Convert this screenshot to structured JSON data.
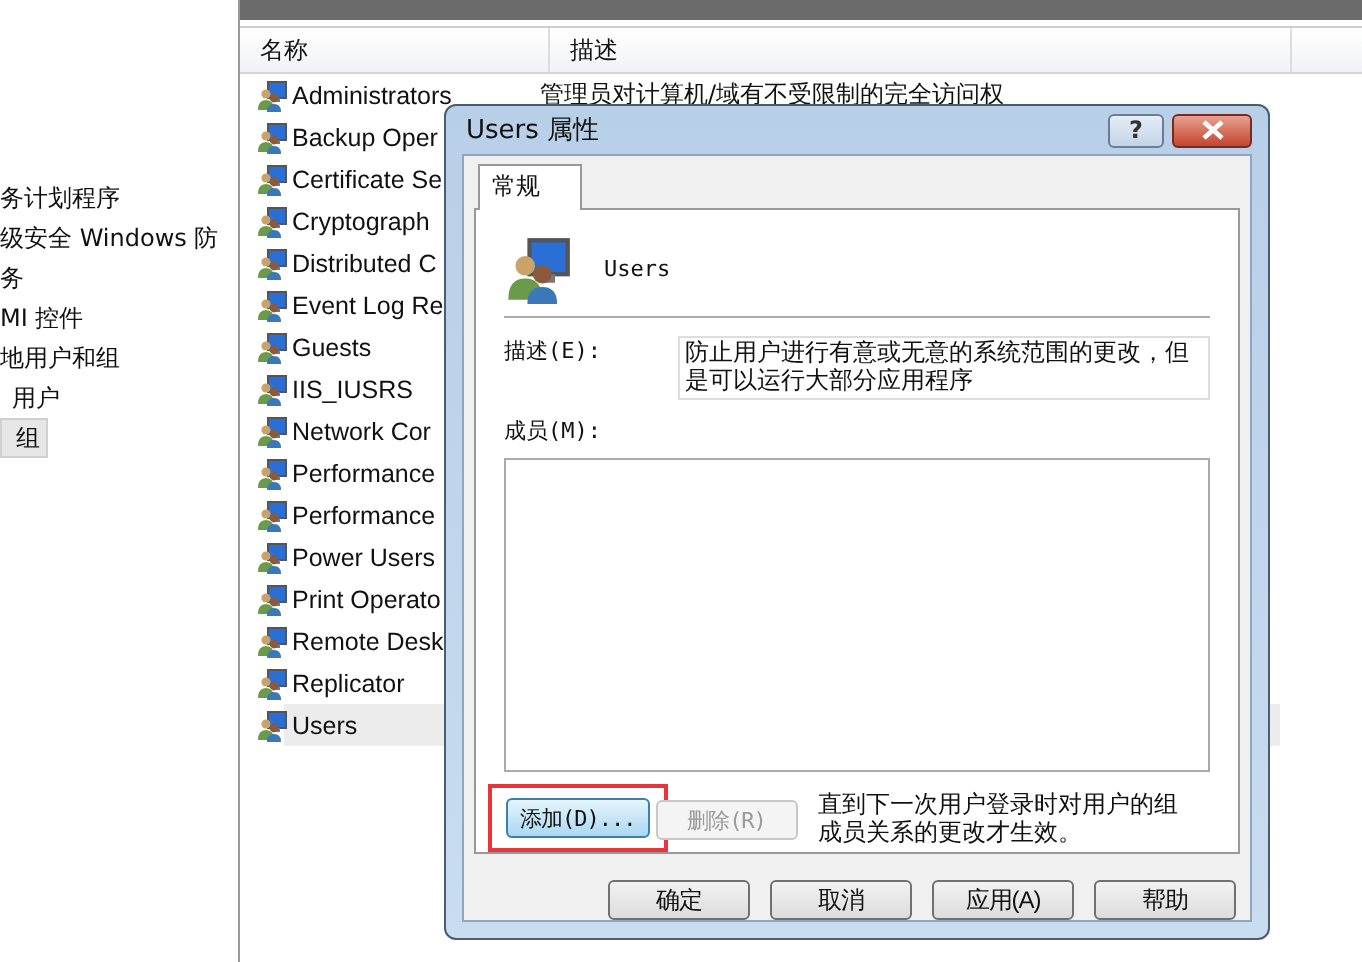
{
  "left_tree": {
    "items": [
      {
        "label": "务计划程序",
        "selected": false
      },
      {
        "label": "级安全 Windows 防",
        "selected": false
      },
      {
        "label": "务",
        "selected": false
      },
      {
        "label": "MI 控件",
        "selected": false
      },
      {
        "label": "地用户和组",
        "selected": false,
        "children": [
          {
            "label": "用户",
            "selected": false
          },
          {
            "label": "组",
            "selected": true
          }
        ]
      }
    ]
  },
  "list": {
    "columns": [
      "名称",
      "描述"
    ],
    "rows": [
      {
        "name": "Administrators",
        "description": "管理员对计算机/域有不受限制的完全访问权",
        "selected": false
      },
      {
        "name": "Backup Oper",
        "selected": false
      },
      {
        "name": "Certificate Se",
        "selected": false
      },
      {
        "name": "Cryptograph",
        "selected": false
      },
      {
        "name": "Distributed C",
        "selected": false
      },
      {
        "name": "Event Log Re",
        "selected": false
      },
      {
        "name": "Guests",
        "selected": false
      },
      {
        "name": "IIS_IUSRS",
        "selected": false
      },
      {
        "name": "Network Cor",
        "selected": false
      },
      {
        "name": "Performance",
        "selected": false
      },
      {
        "name": "Performance",
        "selected": false
      },
      {
        "name": "Power Users",
        "selected": false
      },
      {
        "name": "Print Operato",
        "selected": false
      },
      {
        "name": "Remote Desk",
        "selected": false
      },
      {
        "name": "Replicator",
        "selected": false
      },
      {
        "name": "Users",
        "selected": true
      }
    ]
  },
  "dialog": {
    "title": "Users 属性",
    "help_button": "?",
    "tabs": [
      {
        "label": "常规",
        "selected": true
      }
    ],
    "object_name": "Users",
    "description_label": "描述(E):",
    "description_value": "防止用户进行有意或无意的系统范围的更改，但是可以运行大部分应用程序",
    "members_label": "成员(M):",
    "add_button": {
      "label": "添加(D)...",
      "focused": true,
      "highlighted": true
    },
    "remove_button": {
      "label": "删除(R)",
      "disabled": true
    },
    "note": "直到下一次用户登录时对用户的组成员关系的更改才生效。",
    "buttons": [
      {
        "label": "确定"
      },
      {
        "label": "取消"
      },
      {
        "label": "应用(A)"
      },
      {
        "label": "帮助"
      }
    ]
  }
}
